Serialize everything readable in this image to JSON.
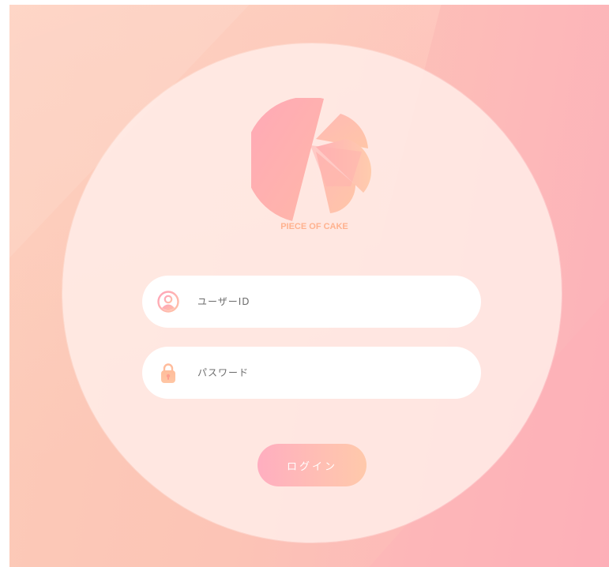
{
  "brand": {
    "name": "PIECE OF CAKE",
    "icon": "cake-slice-logo"
  },
  "form": {
    "user_id": {
      "placeholder": "ユーザーID",
      "value": "",
      "icon": "user-icon"
    },
    "password": {
      "placeholder": "パスワード",
      "value": "",
      "icon": "lock-icon"
    },
    "login_label": "ログイン"
  },
  "colors": {
    "background_left": "#fccbb8",
    "background_right": "#fcb1b9",
    "brand_text": "#ffb28f",
    "button_start": "#ffaec0",
    "button_end": "#ffc9ab"
  }
}
